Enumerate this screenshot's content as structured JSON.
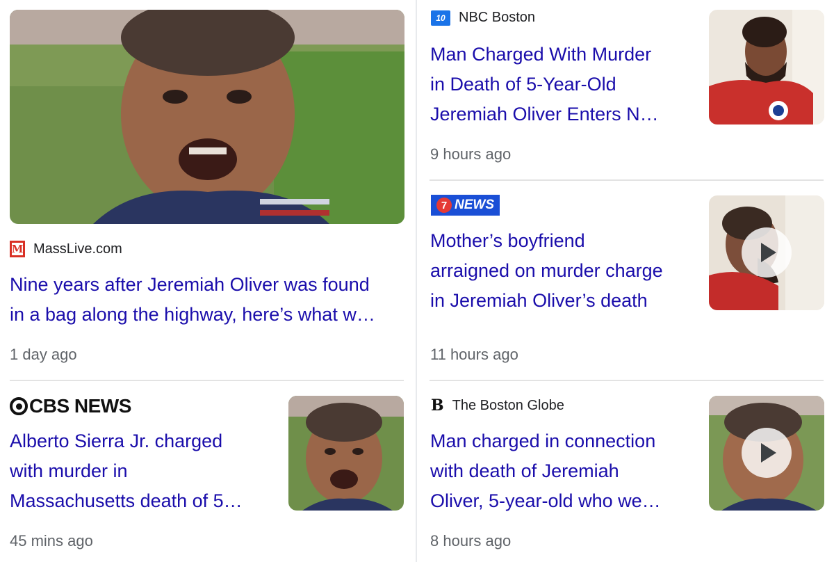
{
  "colors": {
    "headline": "#1a0dab",
    "source": "#202124",
    "time": "#5f6368",
    "divider": "#e3e3e3"
  },
  "articles": [
    {
      "source": "MassLive.com",
      "logo_icon": "masslive-logo-icon",
      "logo_text": "M",
      "headline_lines": [
        "Nine years after Jeremiah Oliver was found",
        "in a bag along the highway, here’s what w…"
      ],
      "time": "1 day ago",
      "image": "boy-portrait-large",
      "has_play": false
    },
    {
      "source": "NBC Boston",
      "logo_icon": "nbc-boston-logo-icon",
      "logo_text": "10",
      "headline_lines": [
        "Man Charged With Murder",
        "in Death of 5-Year-Old",
        "Jeremiah Oliver Enters N…"
      ],
      "time": "9 hours ago",
      "image": "man-red-shirt-photo",
      "has_play": false
    },
    {
      "source": "",
      "logo_icon": "7news-logo-icon",
      "logo_text": "NEWS",
      "logo_badge": "7",
      "headline_lines": [
        "Mother’s boyfriend",
        "arraigned on murder charge",
        "in Jeremiah Oliver’s death"
      ],
      "time": "11 hours ago",
      "image": "man-profile-video-thumbnail",
      "has_play": true
    },
    {
      "source": "",
      "logo_icon": "cbs-news-logo-icon",
      "logo_text": "CBS NEWS",
      "headline_lines": [
        "Alberto Sierra Jr. charged",
        "with murder in",
        "Massachusetts death of 5…"
      ],
      "time": "45 mins ago",
      "image": "boy-portrait-thumbnail",
      "has_play": false
    },
    {
      "source": "The Boston Globe",
      "logo_icon": "boston-globe-logo-icon",
      "logo_text": "B",
      "headline_lines": [
        "Man charged in connection",
        "with death of Jeremiah",
        "Oliver, 5-year-old who we…"
      ],
      "time": "8 hours ago",
      "image": "boy-portrait-video-thumbnail",
      "has_play": true
    }
  ]
}
